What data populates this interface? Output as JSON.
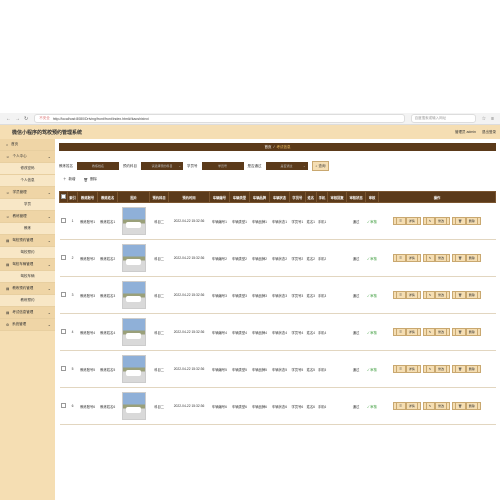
{
  "browser": {
    "insecure": "不安全",
    "url": "http://localhost:8080/Driving/front/front/index.html#/kaoshixinxi",
    "search_placeholder": "百度搜索或输入网址"
  },
  "header": {
    "title": "微信小程序的驾校预约管理系统",
    "user": "管理员 admin",
    "logout": "退出登录"
  },
  "sidebar": {
    "items": [
      {
        "label": "首页",
        "icon": "home-icon",
        "type": "head"
      },
      {
        "label": "个人中心",
        "icon": "person-icon",
        "type": "head",
        "chev": "⌄"
      },
      {
        "label": "修改密码",
        "type": "sub"
      },
      {
        "label": "个人信息",
        "type": "sub"
      },
      {
        "label": "学员管理",
        "icon": "person-icon",
        "type": "head",
        "chev": "⌄"
      },
      {
        "label": "学员",
        "type": "sub"
      },
      {
        "label": "教练管理",
        "icon": "person-icon",
        "type": "head",
        "chev": "⌄"
      },
      {
        "label": "教练",
        "type": "sub"
      },
      {
        "label": "驾校预约管理",
        "icon": "list-icon",
        "type": "head",
        "chev": "⌄"
      },
      {
        "label": "驾校预约",
        "type": "sub"
      },
      {
        "label": "驾校车辆管理",
        "icon": "list-icon",
        "type": "head",
        "chev": "⌄"
      },
      {
        "label": "驾校车辆",
        "type": "sub"
      },
      {
        "label": "教练预约管理",
        "icon": "list-icon",
        "type": "head",
        "chev": "⌄"
      },
      {
        "label": "教练预约",
        "type": "sub"
      },
      {
        "label": "考试信息管理",
        "icon": "list-icon",
        "type": "head",
        "chev": "⌄"
      },
      {
        "label": "系统管理",
        "icon": "gear-icon",
        "type": "head",
        "chev": "⌄"
      }
    ]
  },
  "breadcrumb": {
    "home": "首页",
    "current": "考试信息"
  },
  "filters": {
    "field1_label": "教练姓名",
    "field1_placeholder": "教练姓名",
    "field2_label": "预约科目",
    "field2_placeholder": "请选择预约科目",
    "field3_label": "学员号",
    "field3_placeholder": "学员号",
    "field4_label": "是否通过",
    "field4_placeholder": "是否通过",
    "search": "查询"
  },
  "actions": {
    "add": "新增",
    "delete": "删除"
  },
  "table": {
    "headers": [
      "",
      "索引",
      "教练账号",
      "教练姓名",
      "图片",
      "预约科目",
      "预约时间",
      "车辆编号",
      "车辆类型",
      "车辆品牌",
      "车辆状态",
      "学员号",
      "姓名",
      "手机",
      "审核回复",
      "审核状态",
      "审核",
      "操作"
    ],
    "rows": [
      {
        "idx": "1",
        "acct": "教练账号1",
        "name": "教练姓名1",
        "subj": "科目二",
        "time": "2022-04-22 15:32:36",
        "no": "车辆编号1",
        "type": "车辆类型1",
        "brand": "车辆品牌1",
        "state": "车辆状态1",
        "sid": "学员号1",
        "sname": "姓名1",
        "phone": "手机1",
        "reply": "",
        "status": "通过",
        "audit": "审核"
      },
      {
        "idx": "2",
        "acct": "教练账号2",
        "name": "教练姓名2",
        "subj": "科目二",
        "time": "2022-04-22 15:32:36",
        "no": "车辆编号2",
        "type": "车辆类型2",
        "brand": "车辆品牌2",
        "state": "车辆状态2",
        "sid": "学员号2",
        "sname": "姓名2",
        "phone": "手机2",
        "reply": "",
        "status": "通过",
        "audit": "审核"
      },
      {
        "idx": "3",
        "acct": "教练账号3",
        "name": "教练姓名3",
        "subj": "科目二",
        "time": "2022-04-22 15:32:36",
        "no": "车辆编号3",
        "type": "车辆类型3",
        "brand": "车辆品牌3",
        "state": "车辆状态3",
        "sid": "学员号3",
        "sname": "姓名3",
        "phone": "手机3",
        "reply": "",
        "status": "通过",
        "audit": "审核"
      },
      {
        "idx": "4",
        "acct": "教练账号4",
        "name": "教练姓名4",
        "subj": "科目二",
        "time": "2022-04-22 15:32:36",
        "no": "车辆编号4",
        "type": "车辆类型4",
        "brand": "车辆品牌4",
        "state": "车辆状态4",
        "sid": "学员号4",
        "sname": "姓名4",
        "phone": "手机4",
        "reply": "",
        "status": "通过",
        "audit": "审核"
      },
      {
        "idx": "5",
        "acct": "教练账号5",
        "name": "教练姓名5",
        "subj": "科目二",
        "time": "2022-04-22 15:32:36",
        "no": "车辆编号5",
        "type": "车辆类型5",
        "brand": "车辆品牌5",
        "state": "车辆状态5",
        "sid": "学员号5",
        "sname": "姓名5",
        "phone": "手机5",
        "reply": "",
        "status": "通过",
        "audit": "审核"
      },
      {
        "idx": "6",
        "acct": "教练账号6",
        "name": "教练姓名6",
        "subj": "科目二",
        "time": "2022-04-22 15:32:36",
        "no": "车辆编号6",
        "type": "车辆类型6",
        "brand": "车辆品牌6",
        "state": "车辆状态6",
        "sid": "学员号6",
        "sname": "姓名6",
        "phone": "手机6",
        "reply": "",
        "status": "通过",
        "audit": "审核"
      }
    ],
    "op_detail": "详情",
    "op_edit": "修改",
    "op_delete": "删除"
  },
  "colors": {
    "accent": "#5b3a1a",
    "panel": "#f5deb3",
    "ok": "#3a9b3a"
  }
}
